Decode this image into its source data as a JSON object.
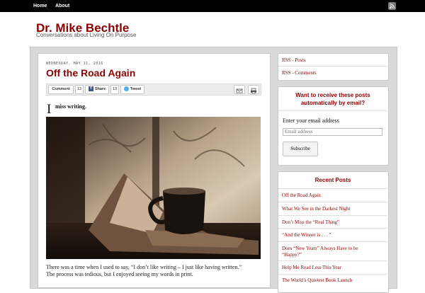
{
  "nav": {
    "home": "Home",
    "about": "About"
  },
  "site": {
    "title": "Dr. Mike Bechtle",
    "description": "Conversations about Living On Purpose"
  },
  "post": {
    "date": "WEDNESDAY, MAY 11, 2016",
    "title": "Off the Road Again",
    "dropcap": "I",
    "lead": "miss writing.",
    "body_line1": "There was a time when I used to say, “I don’t like writing – I just like having written.”",
    "body_line2": "The process was tedious, but I enjoyed seeing my words in print."
  },
  "share": {
    "comment_label": "Comment",
    "comment_count": "13",
    "facebook_label": "Share",
    "facebook_count": "13",
    "twitter_label": "Tweet"
  },
  "sidebar": {
    "rss_posts": "RSS - Posts",
    "rss_comments": "RSS - Comments",
    "email_widget": {
      "title": "Want to receive these posts automatically by email?",
      "label": "Enter your email address",
      "placeholder": "Email address",
      "button": "Subscribe"
    },
    "recent_posts": {
      "title": "Recent Posts",
      "items": [
        "Off the Road Again",
        "What We See in the Darkest Night",
        "Don’t Miss the “Real Thing”",
        "“And the Winner is . . . ”",
        "Does “New Years” Always Have to be “Happy?”",
        "Help Me Read Less This Year",
        "The World’s Quietest Book Launch"
      ]
    }
  },
  "colors": {
    "accent": "#8b0000",
    "nav_bg": "#000000",
    "outer_bg": "#d9d9d9"
  }
}
